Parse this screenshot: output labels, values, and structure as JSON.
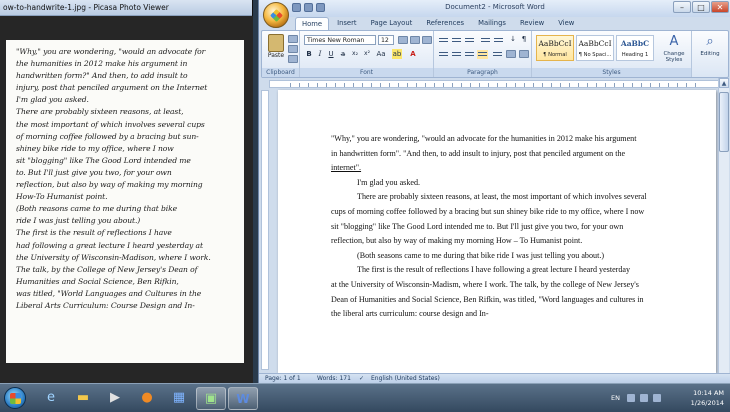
{
  "viewer": {
    "title": "ow-to-handwrite-1.jpg - Picasa Photo Viewer",
    "handwriting_lines": [
      "\"Why,\" you are wondering, \"would an advocate for",
      "the humanities in 2012 make his argument in",
      "handwritten form?\" And then, to add insult to",
      "injury, post that penciled argument on the Internet",
      "      I'm glad you asked.",
      "   There are probably sixteen reasons, at least,",
      "the most important of which involves several cups",
      "of morning coffee followed by a bracing but sun-",
      "shiney bike ride to my office, where I now",
      "sit \"blogging\" like The Good Lord intended me",
      "to. But I'll just give you two, for your own",
      "reflection, but also by way of making my morning",
      "How-To Humanist point.",
      "   (Both reasons came to me during that bike",
      "ride I was just telling you about.)",
      "   The first is the result of reflections I have",
      "had following a great lecture I heard yesterday at",
      "the University of Wisconsin-Madison, where I work.",
      "The talk, by the College of New Jersey's Dean of",
      "Humanities and Social Science, Ben Rifkin,",
      "was titled, \"World Languages and Cultures in the",
      "Liberal Arts Curriculum: Course Design and In-"
    ]
  },
  "word": {
    "title": "Document2 - Microsoft Word",
    "tabs": [
      "Home",
      "Insert",
      "Page Layout",
      "References",
      "Mailings",
      "Review",
      "View"
    ],
    "ribbon": {
      "clipboard_label": "Clipboard",
      "paste_label": "Paste",
      "font_label": "Font",
      "font_name": "Times New Roman",
      "font_size": "12",
      "paragraph_label": "Paragraph",
      "styles_label": "Styles",
      "styles": [
        {
          "preview": "AaBbCcI",
          "name": "¶ Normal"
        },
        {
          "preview": "AaBbCcI",
          "name": "¶ No Spaci..."
        },
        {
          "preview": "AaBbC",
          "name": "Heading 1"
        }
      ],
      "change_styles_label": "Change Styles",
      "editing_label": "Editing"
    },
    "doc_lines": [
      "\"Why,\" you are wondering, \"would an advocate for the humanities in 2012 make his argument",
      "in handwritten form\". \"And then, to add insult to injury, post that penciled argument on the",
      "internet\".",
      "I'm glad you asked.",
      "There are probably sixteen reasons, at least, the most important of which involves several",
      "cups of morning coffee followed by a bracing but sun shiney bike ride to my office, where I now",
      "sit \"blogging\" like The Good Lord intended me to. But I'll just give you two, for your own",
      "reflection, but also by way of making my morning How – To Humanist point.",
      "(Both seasons came to me during that bike ride I was just telling you about.)",
      "The first is the result of reflections I have following a great lecture I heard yesterday",
      "at the University of Wisconsin-Madism, where I work. The talk, by the college of New Jersey's",
      "Dean of Humanities and Social Science, Ben Rifkin, was titled, \"Word languages and cultures in",
      "the liberal arts curriculum: course design and In-"
    ],
    "status": {
      "page": "Page: 1 of 1",
      "words": "Words: 171",
      "language": "English (United States)"
    }
  },
  "taskbar": {
    "lang": "EN",
    "time": "10:14 AM",
    "date": "1/26/2014"
  },
  "colors": {
    "ribbon_blue": "#cfdcec",
    "taskbar": "#34495f"
  }
}
